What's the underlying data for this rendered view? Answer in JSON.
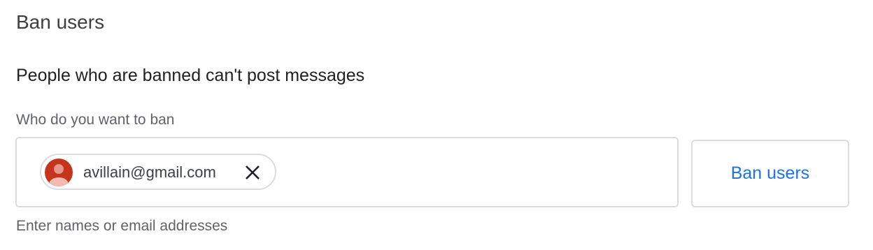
{
  "section": {
    "title": "Ban users",
    "description": "People who are banned can't post messages"
  },
  "field": {
    "label": "Who do you want to ban",
    "helper_text": "Enter names or email addresses"
  },
  "chips": [
    {
      "email": "avillain@gmail.com",
      "avatar_icon": "default-person-avatar",
      "avatar_color": "#c5341b",
      "remove_icon": "close-icon"
    }
  ],
  "actions": {
    "ban_button_label": "Ban users"
  },
  "colors": {
    "accent": "#1a73e8",
    "border": "#dadce0",
    "secondary_text": "#5f6368"
  }
}
